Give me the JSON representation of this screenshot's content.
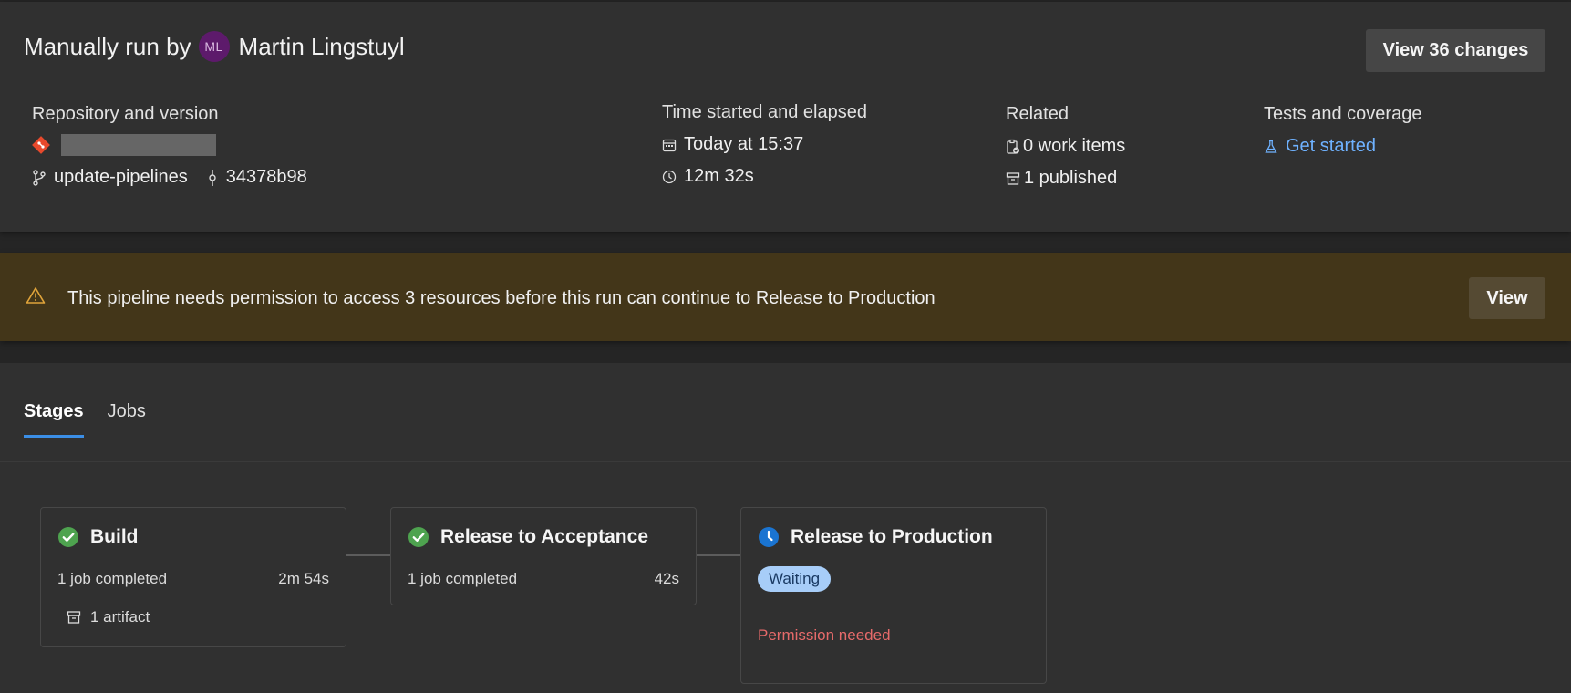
{
  "header": {
    "title_prefix": "Manually run by",
    "avatar_initials": "ML",
    "user_name": "Martin Lingstuyl",
    "view_changes_label": "View 36 changes"
  },
  "repository": {
    "label": "Repository and version",
    "branch": "update-pipelines",
    "commit": "34378b98"
  },
  "time": {
    "label": "Time started and elapsed",
    "started": "Today at 15:37",
    "elapsed": "12m 32s"
  },
  "related": {
    "label": "Related",
    "work_items": "0 work items",
    "published": "1 published"
  },
  "tests": {
    "label": "Tests and coverage",
    "link": "Get started"
  },
  "banner": {
    "message": "This pipeline needs permission to access 3 resources before this run can continue to Release to Production",
    "view_label": "View"
  },
  "tabs": [
    {
      "label": "Stages",
      "active": true
    },
    {
      "label": "Jobs",
      "active": false
    }
  ],
  "stages": [
    {
      "title": "Build",
      "status": "succeeded",
      "jobs": "1 job completed",
      "duration": "2m 54s",
      "artifact": "1 artifact"
    },
    {
      "title": "Release to Acceptance",
      "status": "succeeded",
      "jobs": "1 job completed",
      "duration": "42s"
    },
    {
      "title": "Release to Production",
      "status": "waiting",
      "badge": "Waiting",
      "note": "Permission needed"
    }
  ],
  "colors": {
    "success": "#4ea34f",
    "waiting": "#1a74d1",
    "warning": "#e0a43a",
    "link": "#6fb2ff",
    "error": "#e66a6a"
  }
}
